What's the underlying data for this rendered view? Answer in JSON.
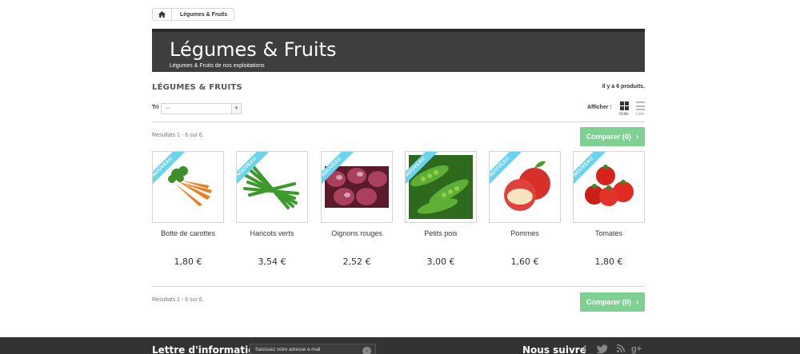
{
  "breadcrumb": {
    "home_icon": "home-icon",
    "current": "Légumes & Fruits"
  },
  "banner": {
    "title": "Légumes & Fruits",
    "subtitle": "Légumes & Fruits de nos exploitations"
  },
  "category": {
    "heading": "LÉGUMES & FRUITS",
    "count_text": "Il y a 6 produits."
  },
  "sort": {
    "label": "Tri",
    "value": "--"
  },
  "view": {
    "label": "Afficher :",
    "grid_label": "Grille",
    "list_label": "Liste"
  },
  "pagination": {
    "results_top": "Résultats 1 - 6 sur 6.",
    "results_bottom": "Résultats 1 - 6 sur 6."
  },
  "compare": {
    "label": "Comparer (0)"
  },
  "products": [
    {
      "badge": "NOUVEAU",
      "name": "Botte de carottes",
      "price": "1,80 €"
    },
    {
      "badge": "NOUVEAU",
      "name": "Haricots verts",
      "price": "3,54 €"
    },
    {
      "badge": "NOUVEAU",
      "name": "Oignons rouges",
      "price": "2,52 €"
    },
    {
      "badge": "NOUVEAU",
      "name": "Petits pois",
      "price": "3,00 €"
    },
    {
      "badge": "NOUVEAU",
      "name": "Pommes",
      "price": "1,60 €"
    },
    {
      "badge": "NOUVEAU",
      "name": "Tomates",
      "price": "1,80 €"
    }
  ],
  "footer": {
    "newsletter_title": "Lettre d'informations",
    "newsletter_placeholder": "Saisissez votre adresse e-mail",
    "follow_title": "Nous suivre",
    "social_icons": [
      "facebook-icon",
      "twitter-icon",
      "rss-icon",
      "google-plus-icon"
    ]
  }
}
